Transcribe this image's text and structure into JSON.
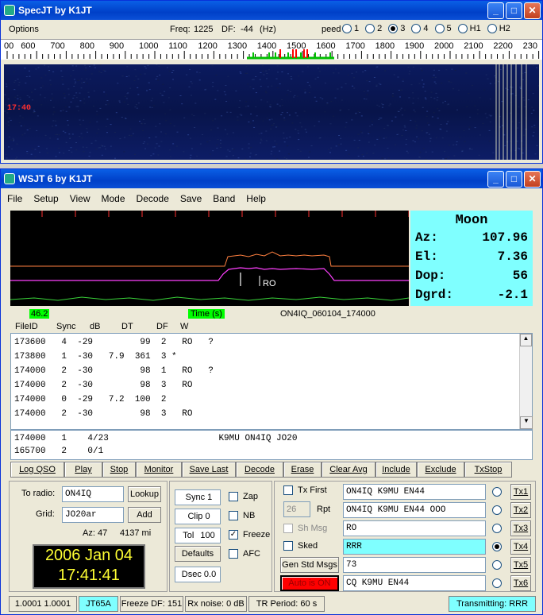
{
  "spec": {
    "title": "SpecJT     by K1JT",
    "options": "Options",
    "freq_label": "Freq:",
    "freq_value": "1225",
    "df_label": "DF:",
    "df_value": "-44",
    "df_unit": "(Hz)",
    "speed_label": "peed",
    "speed_options": [
      "1",
      "2",
      "3",
      "4",
      "5",
      "H1",
      "H2"
    ],
    "speed_selected": "3",
    "scale": [
      "00",
      "600",
      "700",
      "800",
      "900",
      "1000",
      "1100",
      "1200",
      "1300",
      "1400",
      "1500",
      "1600",
      "1700",
      "1800",
      "1900",
      "2000",
      "2100",
      "2200",
      "230"
    ],
    "time_marker": "17:40"
  },
  "wsjt": {
    "title": "WSJT 6     by K1JT",
    "menu": [
      "File",
      "Setup",
      "View",
      "Mode",
      "Decode",
      "Save",
      "Band",
      "Help"
    ],
    "moon": {
      "title": "Moon",
      "rows": [
        {
          "label": "Az:",
          "value": "107.96"
        },
        {
          "label": "El:",
          "value": "7.36"
        },
        {
          "label": "Dop:",
          "value": "56"
        },
        {
          "label": "Dgrd:",
          "value": "-2.1"
        }
      ]
    },
    "plot_label": "RO",
    "badge_left": "46.2",
    "badge_time": "Time (s)",
    "filename": "ON4IQ_060104_174000",
    "columns": [
      "FileID",
      "Sync",
      "dB",
      "DT",
      "DF",
      "W"
    ],
    "decodes": [
      "173600   4  -29         99  2   RO   ?",
      "173800   1  -30   7.9  361  3 *",
      "174000   2  -30         98  1   RO   ?",
      "174000   2  -30         98  3   RO",
      "174000   0  -29   7.2  100  2",
      "174000   2  -30         98  3   RO"
    ],
    "avg": [
      "174000   1    4/23                     K9MU ON4IQ JO20",
      "165700   2    0/1"
    ],
    "buttons": [
      "Log QSO",
      "Play",
      "Stop",
      "Monitor",
      "Save Last",
      "Decode",
      "Erase",
      "Clear Avg",
      "Include",
      "Exclude",
      "TxStop"
    ],
    "to_radio_label": "To radio:",
    "to_radio": "ON4IQ",
    "lookup": "Lookup",
    "grid_label": "Grid:",
    "grid": "JO20ar",
    "add": "Add",
    "az": "Az: 47",
    "dist": "4137 mi",
    "clock_date": "2006 Jan 04",
    "clock_time": "17:41:41",
    "sync": "Sync  1",
    "clip": "Clip  0",
    "tol_label": "Tol",
    "tol": "100",
    "defaults": "Defaults",
    "dsec": "Dsec  0.0",
    "zap": "Zap",
    "nb": "NB",
    "freeze": "Freeze",
    "afc": "AFC",
    "tx_first": "Tx First",
    "rpt_val": "26",
    "rpt": "Rpt",
    "sh_msg": "Sh Msg",
    "sked": "Sked",
    "gen_std": "Gen Std Msgs",
    "auto": "Auto is ON",
    "tx_msgs": [
      "ON4IQ K9MU EN44",
      "ON4IQ K9MU EN44 OOO",
      "RO",
      "RRR",
      "73",
      "CQ K9MU EN44"
    ],
    "tx_labels": [
      "Tx1",
      "Tx2",
      "Tx3",
      "Tx4",
      "Tx5",
      "Tx6"
    ],
    "tx_selected": 3,
    "status": [
      "1.0001 1.0001",
      "JT65A",
      "Freeze DF: 151",
      "Rx noise:  0 dB",
      "TR Period: 60 s"
    ],
    "transmitting": "Transmitting: RRR",
    "colors": {
      "moon_bg": "#7fffff",
      "clock_bg": "#000000",
      "clock_fg": "#ffff33",
      "auto_bg": "#ff0000",
      "green": "#00ff00"
    }
  }
}
